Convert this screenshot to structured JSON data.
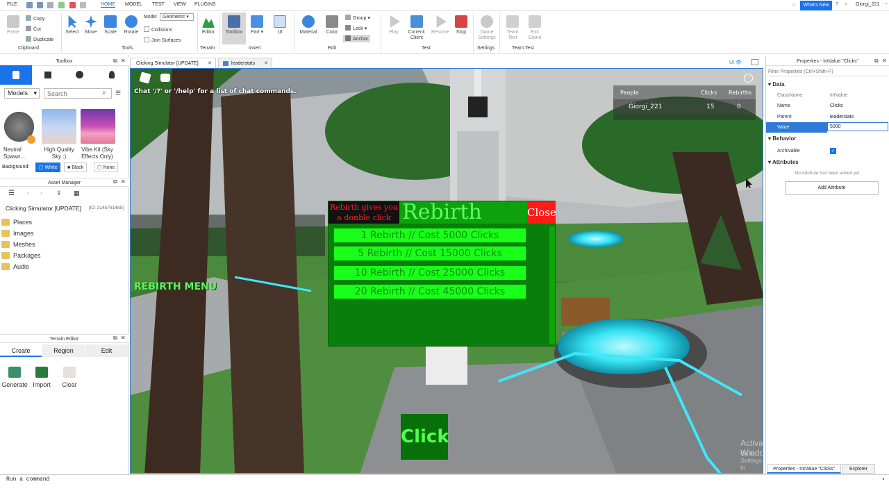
{
  "titlebar": {
    "menus": [
      "FILE",
      "HOME",
      "MODEL",
      "TEST",
      "VIEW",
      "PLUGINS"
    ],
    "active_menu": "HOME",
    "whats_new": "What's New",
    "user": "Giorgi_221"
  },
  "ribbon": {
    "clipboard": {
      "paste": "Paste",
      "copy": "Copy",
      "cut": "Cut",
      "duplicate": "Duplicate",
      "group": "Clipboard"
    },
    "tools": {
      "select": "Select",
      "move": "Move",
      "scale": "Scale",
      "rotate": "Rotate",
      "group": "Tools"
    },
    "mode": {
      "label": "Mode:",
      "value": "Geometric",
      "collisions": "Collisions",
      "join_surfaces": "Join Surfaces"
    },
    "terrain": {
      "editor": "Editor",
      "group": "Terrain"
    },
    "insert": {
      "toolbox": "Toolbox",
      "part": "Part",
      "ui": "UI",
      "group": "Insert"
    },
    "edit": {
      "material": "Material",
      "color": "Color",
      "group_btn": "Group",
      "lock": "Lock",
      "anchor": "Anchor",
      "group": "Edit"
    },
    "test": {
      "play": "Play",
      "current_client_1": "Current:",
      "current_client_2": "Client",
      "resume": "Resume",
      "stop": "Stop",
      "group": "Test"
    },
    "settings": {
      "game_1": "Game",
      "game_2": "Settings",
      "group": "Settings"
    },
    "team_test": {
      "team_1": "Team",
      "team_2": "Test",
      "exit_1": "Exit",
      "exit_2": "Game",
      "group": "Team Test"
    }
  },
  "toolbox": {
    "title": "Toolbox",
    "category": "Models",
    "search_placeholder": "Search",
    "items": [
      {
        "label1": "Neutral",
        "label2": "Spawn..."
      },
      {
        "label1": "High Quality",
        "label2": "Sky :)"
      },
      {
        "label1": "Vibe Kit (Sky",
        "label2": "Effects Only)"
      }
    ],
    "background_label": "Background:",
    "bg_white": "White",
    "bg_black": "Black",
    "bg_none": "None"
  },
  "asset_manager": {
    "title": "Asset Manager",
    "game": "Clicking Simulator [UPDATE]",
    "id": "[ID: 3145761485]",
    "folders": [
      "Places",
      "Images",
      "Meshes",
      "Packages",
      "Audio"
    ]
  },
  "terrain_editor": {
    "title": "Terrain Editor",
    "tabs": [
      "Create",
      "Region",
      "Edit"
    ],
    "buttons": [
      "Generate",
      "Import",
      "Clear"
    ]
  },
  "doc_tabs": [
    "Clicking Simulator [UPDATE]",
    "leaderstats"
  ],
  "game": {
    "chat_hint": "Chat '/?' or '/help' for a list of chat commands.",
    "leaderboard": {
      "col_people": "People",
      "col_clicks": "Clicks",
      "col_rebirths": "Rebirths",
      "player": "Giorgi_221",
      "clicks": "15",
      "rebirths": "0"
    },
    "rebirth_menu_btn": "REBIRTH MENU",
    "rebirth": {
      "tip_line1": "Rebirth gives you",
      "tip_line2": "a double click",
      "title": "Rebirth",
      "close": "Close",
      "options": [
        "1 Rebirth // Cost 5000 Clicks",
        "5 Rebirth // Cost 15000 Clicks",
        "10 Rebirth // Cost 25000 Clicks",
        "20 Rebirth // Cost 45000 Clicks"
      ]
    },
    "click_btn": "Click",
    "watermark1": "Activate Windows",
    "watermark2": "Go to Settings to activate Windows."
  },
  "properties": {
    "title": "Properties - IntValue \"Clicks\"",
    "filter_placeholder": "Filter Properties (Ctrl+Shift+P)",
    "sec_data": "Data",
    "rows": [
      {
        "k": "ClassName",
        "v": "IntValue"
      },
      {
        "k": "Name",
        "v": "Clicks"
      },
      {
        "k": "Parent",
        "v": "leaderstats"
      },
      {
        "k": "Value",
        "v": "5000"
      }
    ],
    "sec_behavior": "Behavior",
    "archivable": "Archivable",
    "sec_attributes": "Attributes",
    "no_attr": "No Attribute has been added yet",
    "add_attr": "Add Attribute",
    "bottom_tab1": "Properties - IntValue \"Clicks\"",
    "bottom_tab2": "Explorer"
  },
  "command_bar": "Run a command",
  "colors": {
    "accent": "#1a73e8",
    "rebirth_green": "#19ff19",
    "panel_green": "#0a7e0a",
    "close_red": "#ff1a1a"
  }
}
